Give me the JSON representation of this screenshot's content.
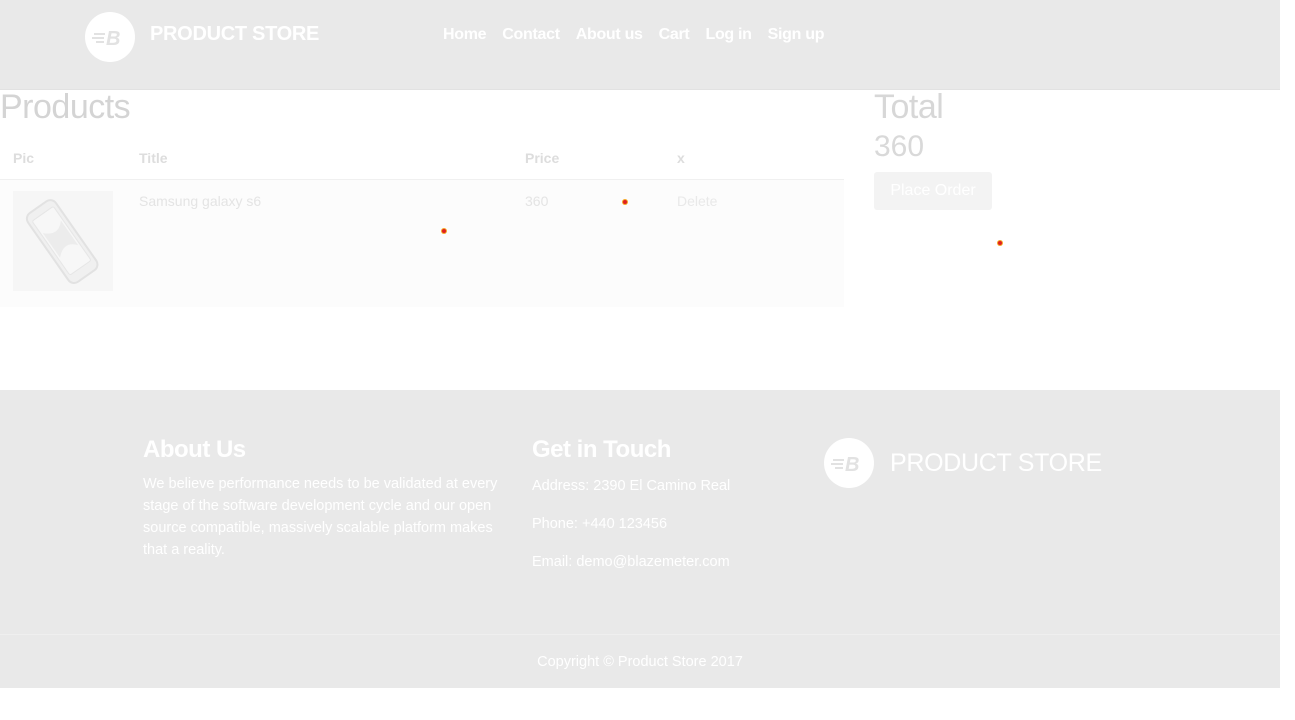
{
  "navbar": {
    "brand": "PRODUCT STORE",
    "links": [
      "Home",
      "Contact",
      "About us",
      "Cart",
      "Log in",
      "Sign up"
    ]
  },
  "products": {
    "title": "Products",
    "columns": [
      "Pic",
      "Title",
      "Price",
      "x"
    ],
    "rows": [
      {
        "title": "Samsung galaxy s6",
        "price": "360",
        "action": "Delete"
      }
    ]
  },
  "total": {
    "title": "Total",
    "value": "360",
    "button": "Place Order"
  },
  "footer": {
    "about_title": "About Us",
    "about_text": "We believe performance needs to be validated at every stage of the software development cycle and our open source compatible, massively scalable platform makes that a reality.",
    "touch_title": "Get in Touch",
    "address": "Address: 2390 El Camino Real",
    "phone": "Phone: +440 123456",
    "email": "Email: demo@blazemeter.com",
    "brand": "PRODUCT STORE",
    "copyright": "Copyright © Product Store 2017"
  },
  "colors": {
    "bar_bg": "#e9e9e9",
    "muted_text": "#d4d4d4",
    "marker": "#e02020"
  }
}
